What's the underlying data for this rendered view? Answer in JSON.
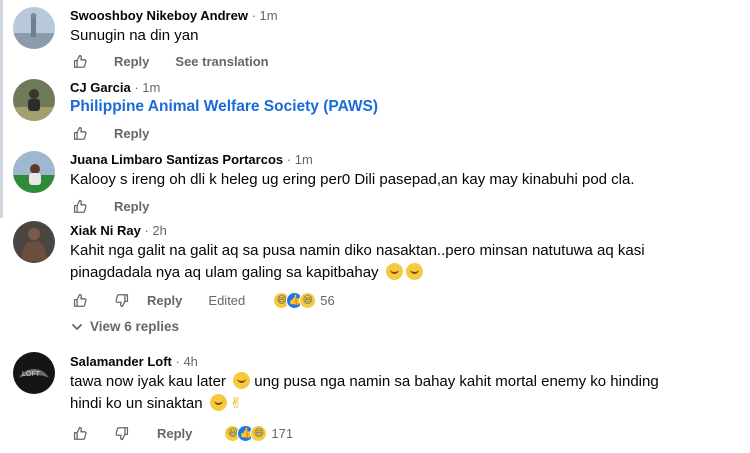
{
  "comments": [
    {
      "author": "Swooshboy Nikeboy Andrew",
      "time": "1m",
      "text": "Sunugin na din yan",
      "actions": {
        "reply": "Reply",
        "translate": "See translation"
      }
    },
    {
      "author": "CJ Garcia",
      "time": "1m",
      "text": "Philippine Animal Welfare Society (PAWS)",
      "actions": {
        "reply": "Reply"
      }
    },
    {
      "author": "Juana Limbaro Santizas Portarcos",
      "time": "1m",
      "text": "Kalooy s ireng oh dli k heleg ug ering per0 Dili pasepad,an kay may kinabuhi pod cla.",
      "actions": {
        "reply": "Reply"
      }
    },
    {
      "author": "Xiak Ni Ray",
      "time": "2h",
      "text_line1": "Kahit nga galit na galit aq sa pusa namin diko nasaktan..pero minsan natutuwa aq kasi",
      "text_line2": "pinagdadala nya aq ulam galing sa kapitbahay",
      "actions": {
        "reply": "Reply",
        "edited": "Edited",
        "reaction_count": "56"
      },
      "view_replies": "View 6 replies"
    },
    {
      "author": "Salamander Loft",
      "time": "4h",
      "text_line1": "tawa now iyak kau later",
      "text_line1b": "ung pusa nga namin sa bahay kahit mortal enemy ko hinding",
      "text_line2": "hindi ko un sinaktan",
      "actions": {
        "reply": "Reply",
        "reaction_count": "171"
      }
    }
  ],
  "separator": "·",
  "colors": {
    "link": "#1a6bd6",
    "secondary": "#65676b",
    "like": "#1877f2",
    "haha": "#f7c93e"
  }
}
